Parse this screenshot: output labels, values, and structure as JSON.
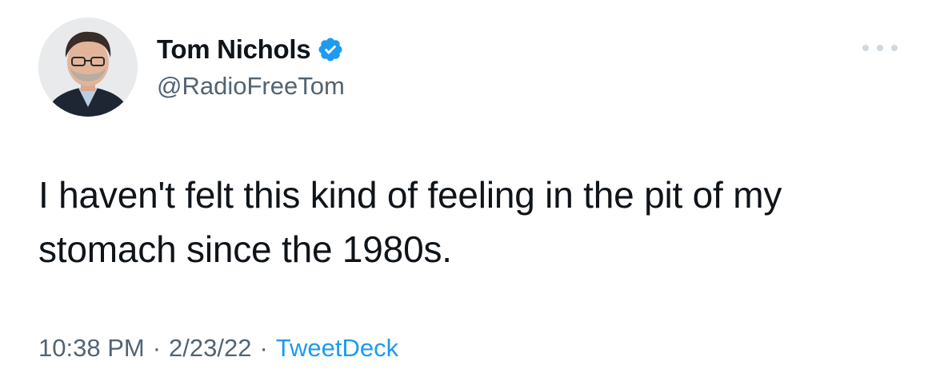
{
  "author": {
    "display_name": "Tom Nichols",
    "handle": "@RadioFreeTom",
    "verified": true,
    "avatar_icon": "profile-photo"
  },
  "tweet": {
    "text": "I haven't felt this kind of feeling in the pit of my stomach since the 1980s."
  },
  "meta": {
    "time": "10:38 PM",
    "separator": "·",
    "date": "2/23/22",
    "source": "TweetDeck"
  },
  "colors": {
    "text": "#0f1419",
    "secondary": "#536471",
    "accent": "#1d9bf0",
    "more_dots": "#cfd9de"
  },
  "icons": {
    "verified": "verified-badge-icon",
    "more": "more-options-icon"
  }
}
